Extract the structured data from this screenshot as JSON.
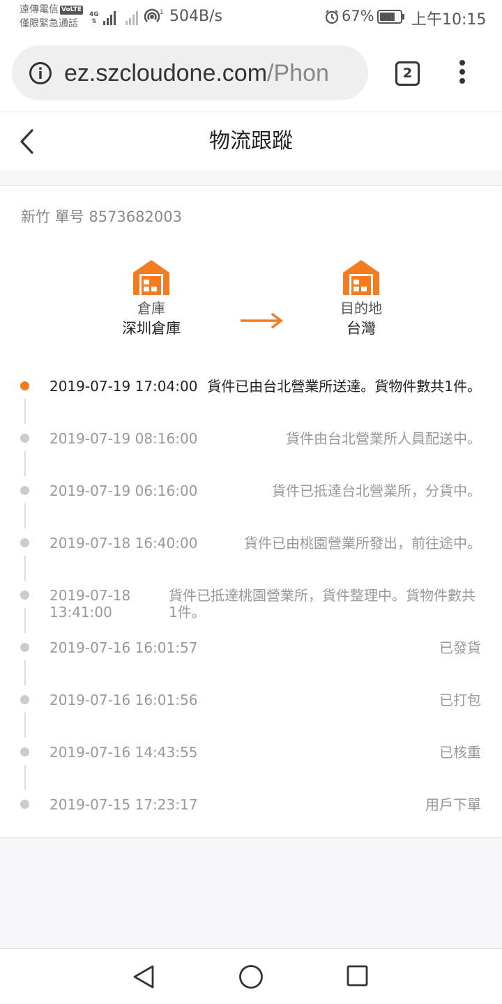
{
  "status_bar": {
    "carrier_line1": "遠傳電信",
    "volte": "VoLTE",
    "carrier_line2": "僅限緊急通話",
    "network": "4G",
    "speed": "504B/s",
    "battery": "67%",
    "time": "上午10:15",
    "icons": [
      "signal-icon",
      "no-signal-icon",
      "hotspot-icon",
      "alarm-icon",
      "battery-icon"
    ]
  },
  "browser": {
    "url_host": "ez.szcloudone.com",
    "url_path": "/Phon",
    "tab_count": "2"
  },
  "header": {
    "title": "物流跟蹤"
  },
  "order": {
    "text": "新竹 單号 8573682003"
  },
  "route": {
    "origin_label": "倉庫",
    "origin_value": "深圳倉庫",
    "dest_label": "目的地",
    "dest_value": "台灣",
    "accent_color": "#f47b20"
  },
  "events": [
    {
      "time": "2019-07-19 17:04:00",
      "desc": "貨件已由台北營業所送達。貨物件數共1件。"
    },
    {
      "time": "2019-07-19 08:16:00",
      "desc": "貨件由台北營業所人員配送中。"
    },
    {
      "time": "2019-07-19 06:16:00",
      "desc": "貨件已抵達台北營業所，分貨中。"
    },
    {
      "time": "2019-07-18 16:40:00",
      "desc": "貨件已由桃園營業所發出，前往途中。"
    },
    {
      "time": "2019-07-18 13:41:00",
      "desc": "貨件已抵達桃園營業所，貨件整理中。貨物件數共1件。"
    },
    {
      "time": "2019-07-16 16:01:57",
      "desc": "已發貨"
    },
    {
      "time": "2019-07-16 16:01:56",
      "desc": "已打包"
    },
    {
      "time": "2019-07-16 14:43:55",
      "desc": "已核重"
    },
    {
      "time": "2019-07-15 17:23:17",
      "desc": "用戶下單"
    }
  ]
}
